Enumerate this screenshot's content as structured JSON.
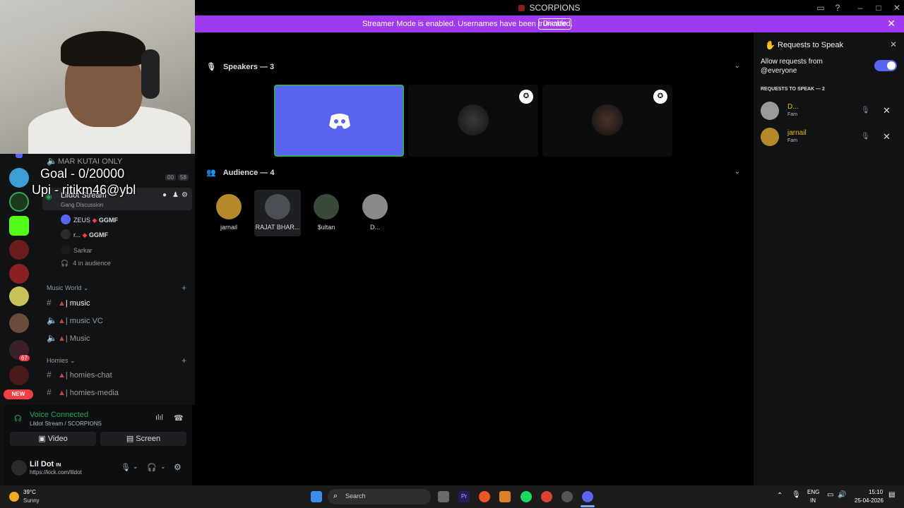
{
  "window": {
    "title": "SCORPIONS"
  },
  "banner": {
    "message": "Streamer Mode is enabled. Usernames have been truncated.",
    "disable_label": "Disable"
  },
  "overlay": {
    "goal": "Goal - 0/20000",
    "upi": "Upi - ritikm46@ybl"
  },
  "rail": {
    "new_badge": "NEW",
    "mention_count": "67"
  },
  "channels": {
    "top_channel": "MAR KUTAI ONLY",
    "counts": {
      "left": "00",
      "right": "58"
    },
    "stage_channel": "Lildot Stream",
    "stage_topic": "Gang Discussion",
    "speakers": [
      {
        "name": "ZEUS",
        "tag": "GGMF"
      },
      {
        "name": "r...",
        "tag": "GGMF"
      },
      {
        "name": "Sarkar",
        "tag": ""
      }
    ],
    "audience_count": "4 in audience",
    "categories": [
      {
        "name": "Music World",
        "items": [
          {
            "icon": "hash",
            "label": "| music",
            "active": true
          },
          {
            "icon": "speaker",
            "label": "| music VC",
            "active": false
          },
          {
            "icon": "speaker",
            "label": "| Music",
            "active": false
          }
        ]
      },
      {
        "name": "Homies",
        "items": [
          {
            "icon": "hash",
            "label": "| homies-chat",
            "active": false
          },
          {
            "icon": "hash",
            "label": "| homies-media",
            "active": false
          }
        ]
      }
    ]
  },
  "voice": {
    "status": "Voice Connected",
    "location": "Lildot Stream / SCORPIONS",
    "video_label": "Video",
    "screen_label": "Screen"
  },
  "user": {
    "name": "Lil Dot",
    "flag": "IN",
    "status": "https://kick.com/lildot"
  },
  "stage": {
    "speakers_header": "Speakers — 3",
    "audience_header": "Audience — 4",
    "audience": [
      {
        "label": "jarnail",
        "color": "#b5892a"
      },
      {
        "label": "RAJAT BHAR...",
        "color": "#4a4f56"
      },
      {
        "label": "$ultan",
        "color": "#3a4a3a"
      },
      {
        "label": "D...",
        "color": "#8a8a8a"
      }
    ]
  },
  "requests": {
    "title": "Requests to Speak",
    "allow_label": "Allow requests from @everyone",
    "toggle_on": true,
    "section": "REQUESTS TO SPEAK — 2",
    "list": [
      {
        "name": "D...",
        "role": "Fam",
        "color": "#9a9a9a"
      },
      {
        "name": "jarnail",
        "role": "Fam",
        "color": "#b5892a"
      }
    ]
  },
  "taskbar": {
    "weather_temp": "39°C",
    "weather_desc": "Sunny",
    "search_label": "Search",
    "lang_top": "ENG",
    "lang_bottom": "IN",
    "time": "15:10",
    "date": "25-04-2026"
  }
}
